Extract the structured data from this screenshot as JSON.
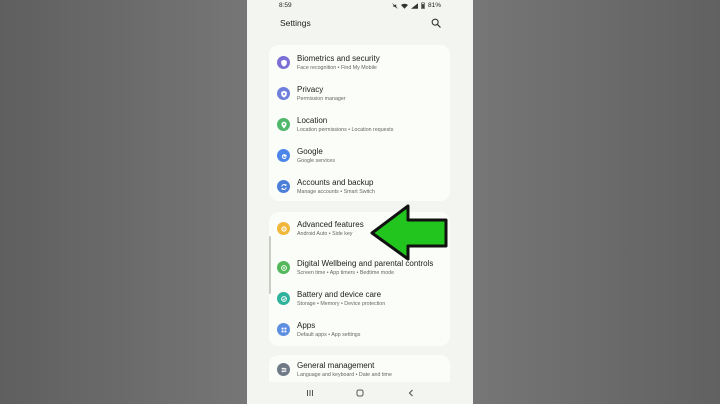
{
  "status_bar": {
    "time": "8:59",
    "battery": "81%"
  },
  "header": {
    "title": "Settings",
    "search_icon": "search-icon"
  },
  "cards": [
    {
      "items": [
        {
          "title": "Biometrics and security",
          "subtitle": "Face recognition • Find My Mobile",
          "icon": "shield-icon",
          "color": "#7b6fd6"
        },
        {
          "title": "Privacy",
          "subtitle": "Permission manager",
          "icon": "privacy-icon",
          "color": "#6f7fdc"
        },
        {
          "title": "Location",
          "subtitle": "Location permissions • Location requests",
          "icon": "location-icon",
          "color": "#4fb86a"
        },
        {
          "title": "Google",
          "subtitle": "Google services",
          "icon": "google-icon",
          "color": "#4b86e8"
        },
        {
          "title": "Accounts and backup",
          "subtitle": "Manage accounts • Smart Switch",
          "icon": "sync-icon",
          "color": "#4b7fd8"
        }
      ]
    },
    {
      "items": [
        {
          "title": "Advanced features",
          "subtitle": "Android Auto • Side key",
          "icon": "gear-plus-icon",
          "color": "#f0b73a"
        },
        {
          "title": "Digital Wellbeing and parental controls",
          "subtitle": "Screen time • App timers • Bedtime mode",
          "icon": "wellbeing-icon",
          "color": "#53b85a"
        },
        {
          "title": "Battery and device care",
          "subtitle": "Storage • Memory • Device protection",
          "icon": "device-care-icon",
          "color": "#2fb29c"
        },
        {
          "title": "Apps",
          "subtitle": "Default apps • App settings",
          "icon": "apps-grid-icon",
          "color": "#5d8fe0"
        }
      ]
    },
    {
      "items": [
        {
          "title": "General management",
          "subtitle": "Language and keyboard • Date and time",
          "icon": "sliders-icon",
          "color": "#6f7a86"
        }
      ]
    }
  ],
  "nav_bar": {
    "recents": "recents-icon",
    "home": "home-icon",
    "back": "back-icon"
  },
  "overlay": {
    "arrow_color": "#22c51e",
    "arrow_icon": "green-arrow-icon"
  }
}
